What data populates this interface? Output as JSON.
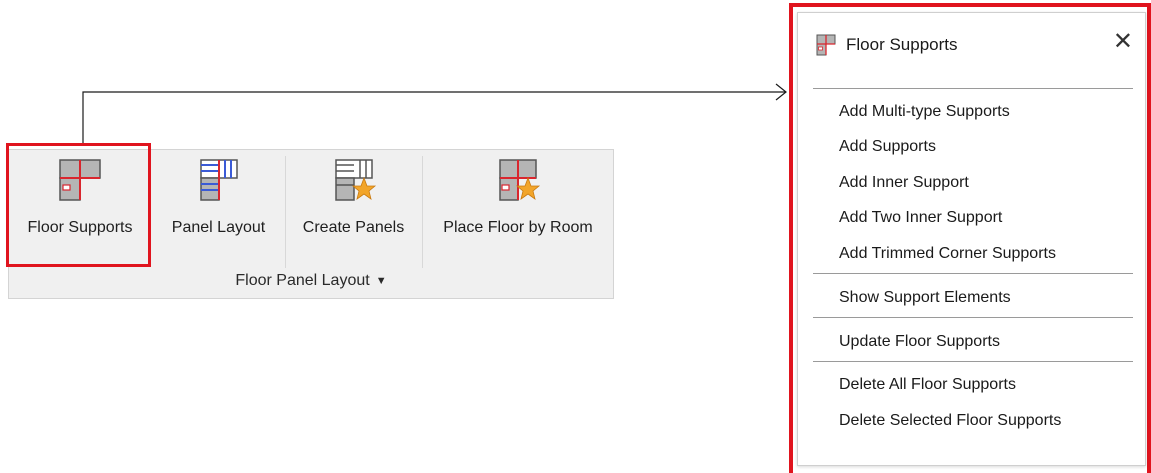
{
  "ribbon": {
    "buttons": [
      {
        "label": "Floor Supports",
        "icon": "floor-supports-icon"
      },
      {
        "label": "Panel Layout",
        "icon": "panel-layout-icon"
      },
      {
        "label": "Create Panels",
        "icon": "create-panels-icon"
      },
      {
        "label": "Place Floor by Room",
        "icon": "place-floor-by-room-icon"
      }
    ],
    "panel_title": "Floor Panel Layout",
    "dropdown_glyph": "▼"
  },
  "dropdown": {
    "title": "Floor Supports",
    "close_glyph": "✕",
    "groups": [
      [
        "Add Multi-type Supports",
        "Add Supports",
        "Add Inner Support",
        "Add Two Inner Support",
        "Add Trimmed Corner Supports"
      ],
      [
        "Show Support Elements"
      ],
      [
        "Update Floor Supports"
      ],
      [
        "Delete All Floor Supports",
        "Delete Selected Floor Supports"
      ]
    ]
  },
  "colors": {
    "highlight": "#e0141e",
    "ribbon_bg": "#f0f0f0",
    "icon_red": "#d9262e",
    "icon_blue": "#3b5bd6",
    "star": "#f2a52a"
  }
}
